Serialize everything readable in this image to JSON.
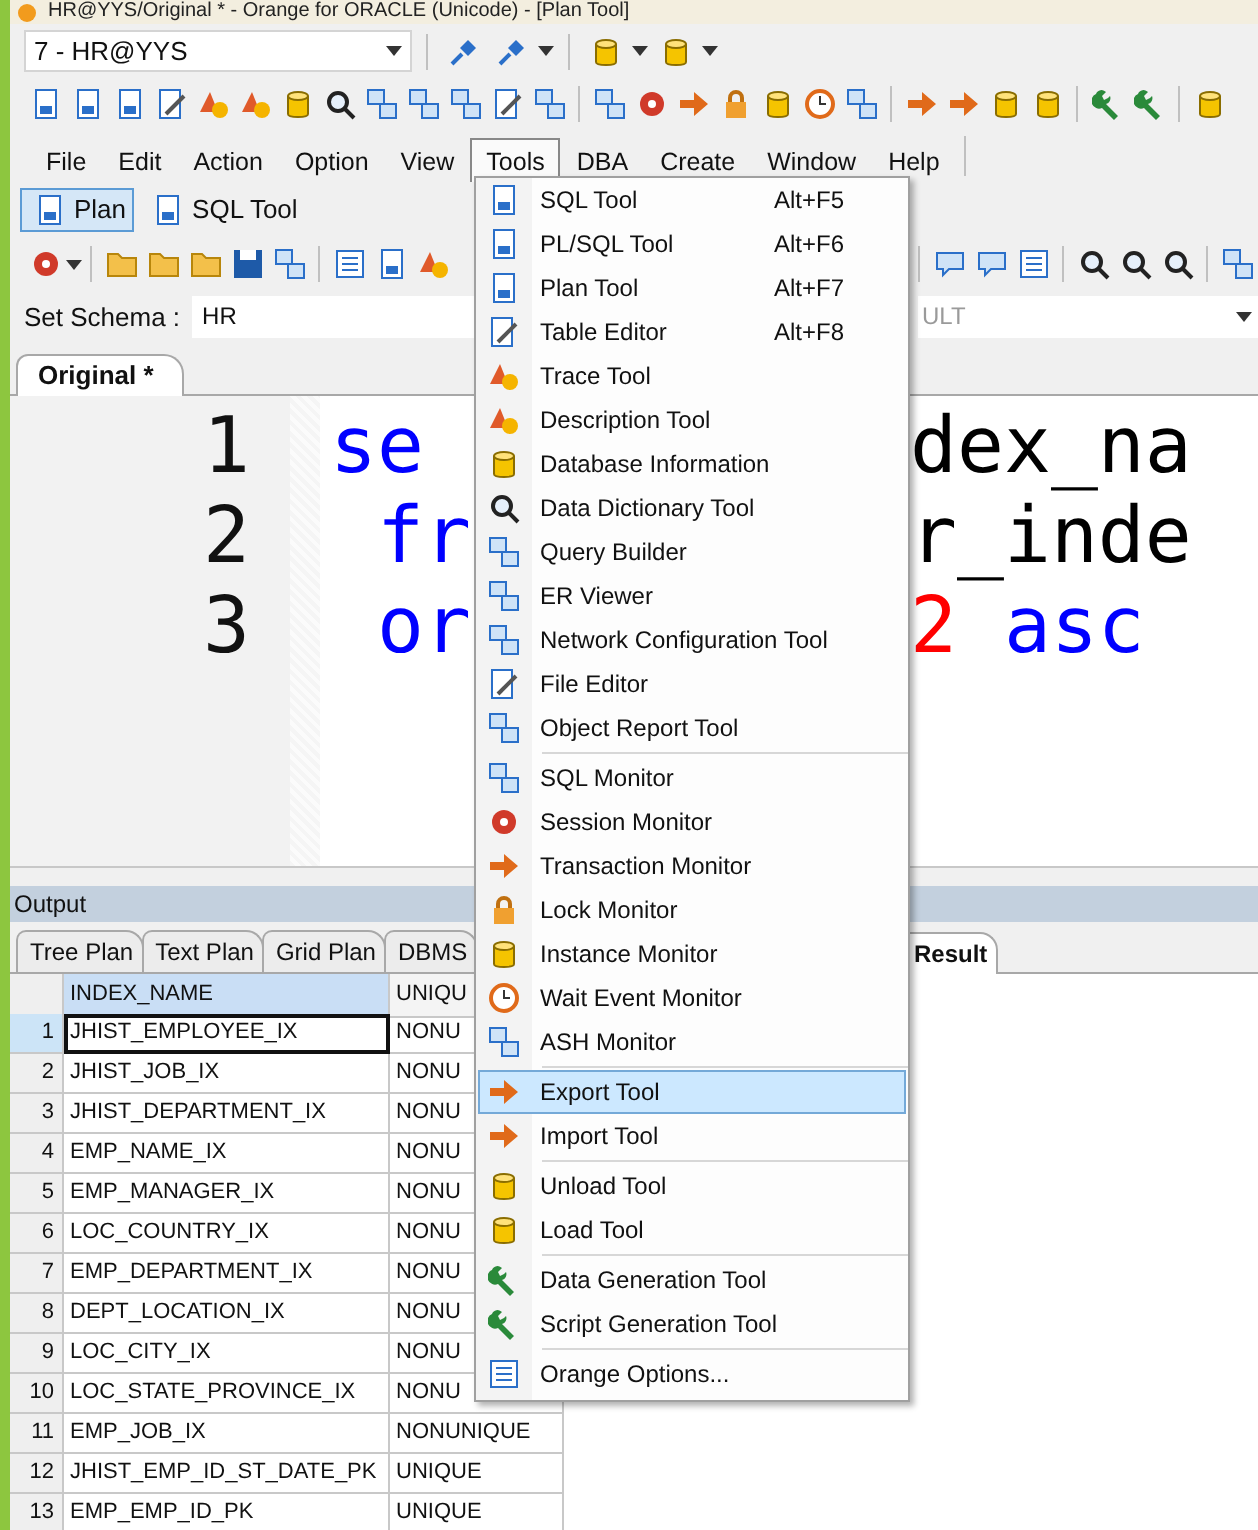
{
  "window": {
    "title": "HR@YYS/Original * - Orange for ORACLE (Unicode) - [Plan Tool]"
  },
  "connection": {
    "value": "7 - HR@YYS"
  },
  "menubar": [
    {
      "label": "File",
      "selected": false
    },
    {
      "label": "Edit",
      "selected": false
    },
    {
      "label": "Action",
      "selected": false
    },
    {
      "label": "Option",
      "selected": false
    },
    {
      "label": "View",
      "selected": false
    },
    {
      "label": "Tools",
      "selected": true
    },
    {
      "label": "DBA",
      "selected": false
    },
    {
      "label": "Create",
      "selected": false
    },
    {
      "label": "Window",
      "selected": false
    },
    {
      "label": "Help",
      "selected": false
    }
  ],
  "tool_tabs": [
    {
      "label": "Plan",
      "selected": true
    },
    {
      "label": "SQL Tool",
      "selected": false
    }
  ],
  "schema": {
    "label": "Set Schema :",
    "value": "HR",
    "field_2": "ULT"
  },
  "editor": {
    "tab": "Original *",
    "lines": [
      {
        "number": "1",
        "left": [
          {
            "text": "se",
            "kind": "keyword"
          }
        ],
        "right": [
          {
            "text": "dex_na",
            "kind": "plain"
          }
        ]
      },
      {
        "number": "2",
        "left": [
          {
            "text": " fr",
            "kind": "keyword"
          }
        ],
        "right": [
          {
            "text": "r_inde",
            "kind": "plain"
          }
        ]
      },
      {
        "number": "3",
        "left": [
          {
            "text": " or",
            "kind": "keyword"
          }
        ],
        "right": [
          {
            "text": "2",
            "kind": "number"
          },
          {
            "text": " asc",
            "kind": "keyword"
          }
        ]
      }
    ]
  },
  "output": {
    "title": "Output",
    "tabs": [
      {
        "label": "Tree Plan",
        "selected": false
      },
      {
        "label": "Text Plan",
        "selected": false
      },
      {
        "label": "Grid Plan",
        "selected": false
      },
      {
        "label": "DBMS",
        "selected": false
      },
      {
        "label": "Result",
        "selected": true
      }
    ],
    "grid": {
      "columns": [
        {
          "label": "INDEX_NAME",
          "selected": true
        },
        {
          "label": "UNIQU",
          "selected": false
        }
      ],
      "rows": [
        {
          "number": "1",
          "cells": [
            "JHIST_EMPLOYEE_IX",
            "NONU"
          ],
          "selected": true
        },
        {
          "number": "2",
          "cells": [
            "JHIST_JOB_IX",
            "NONU"
          ],
          "selected": false
        },
        {
          "number": "3",
          "cells": [
            "JHIST_DEPARTMENT_IX",
            "NONU"
          ],
          "selected": false
        },
        {
          "number": "4",
          "cells": [
            "EMP_NAME_IX",
            "NONU"
          ],
          "selected": false
        },
        {
          "number": "5",
          "cells": [
            "EMP_MANAGER_IX",
            "NONU"
          ],
          "selected": false
        },
        {
          "number": "6",
          "cells": [
            "LOC_COUNTRY_IX",
            "NONU"
          ],
          "selected": false
        },
        {
          "number": "7",
          "cells": [
            "EMP_DEPARTMENT_IX",
            "NONU"
          ],
          "selected": false
        },
        {
          "number": "8",
          "cells": [
            "DEPT_LOCATION_IX",
            "NONU"
          ],
          "selected": false
        },
        {
          "number": "9",
          "cells": [
            "LOC_CITY_IX",
            "NONU"
          ],
          "selected": false
        },
        {
          "number": "10",
          "cells": [
            "LOC_STATE_PROVINCE_IX",
            "NONU"
          ],
          "selected": false
        },
        {
          "number": "11",
          "cells": [
            "EMP_JOB_IX",
            "NONUNIQUE"
          ],
          "selected": false
        },
        {
          "number": "12",
          "cells": [
            "JHIST_EMP_ID_ST_DATE_PK",
            "UNIQUE"
          ],
          "selected": false
        },
        {
          "number": "13",
          "cells": [
            "EMP_EMP_ID_PK",
            "UNIQUE"
          ],
          "selected": false
        }
      ]
    }
  },
  "tools_menu": {
    "groups": [
      [
        {
          "label": "SQL Tool",
          "shortcut": "Alt+F5",
          "selected": false
        },
        {
          "label": "PL/SQL Tool",
          "shortcut": "Alt+F6",
          "selected": false
        },
        {
          "label": "Plan Tool",
          "shortcut": "Alt+F7",
          "selected": false
        },
        {
          "label": "Table Editor",
          "shortcut": "Alt+F8",
          "selected": false
        },
        {
          "label": "Trace Tool",
          "selected": false
        },
        {
          "label": "Description Tool",
          "selected": false
        },
        {
          "label": "Database Information",
          "selected": false
        },
        {
          "label": "Data Dictionary Tool",
          "selected": false
        },
        {
          "label": "Query Builder",
          "selected": false
        },
        {
          "label": "ER Viewer",
          "selected": false
        },
        {
          "label": "Network Configuration Tool",
          "selected": false
        },
        {
          "label": "File Editor",
          "selected": false
        },
        {
          "label": "Object Report Tool",
          "selected": false
        }
      ],
      [
        {
          "label": "SQL Monitor",
          "selected": false
        },
        {
          "label": "Session Monitor",
          "selected": false
        },
        {
          "label": "Transaction Monitor",
          "selected": false
        },
        {
          "label": "Lock Monitor",
          "selected": false
        },
        {
          "label": "Instance Monitor",
          "selected": false
        },
        {
          "label": "Wait Event Monitor",
          "selected": false
        },
        {
          "label": "ASH Monitor",
          "selected": false
        }
      ],
      [
        {
          "label": "Export Tool",
          "selected": true
        },
        {
          "label": "Import Tool",
          "selected": false
        }
      ],
      [
        {
          "label": "Unload Tool",
          "selected": false
        },
        {
          "label": "Load Tool",
          "selected": false
        }
      ],
      [
        {
          "label": "Data Generation Tool",
          "selected": false
        },
        {
          "label": "Script Generation Tool",
          "selected": false
        }
      ],
      [
        {
          "label": "Orange Options...",
          "selected": false
        }
      ]
    ]
  }
}
